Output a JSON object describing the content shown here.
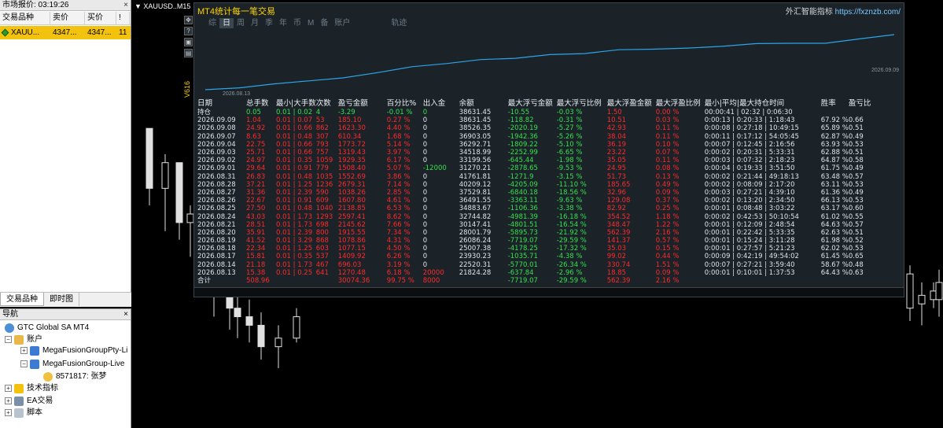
{
  "market_watch": {
    "title": "市场报价: 03:19:26",
    "columns": [
      "交易品种",
      "卖价",
      "买价",
      "!"
    ],
    "row": {
      "symbol": "XAUU...",
      "bid": "4347...",
      "ask": "4347...",
      "spread": "11"
    },
    "tabs": [
      "交易品种",
      "即时图"
    ]
  },
  "navigator": {
    "title": "导航",
    "root": "GTC Global SA MT4",
    "accounts_label": "账户",
    "server1": "MegaFusionGroupPty-Li",
    "server2": "MegaFusionGroup-Live",
    "account": "8571817: 张梦",
    "indicators": "技术指标",
    "ea": "EA交易",
    "scripts": "脚本"
  },
  "chart": {
    "symbol_label": "XAUUSD..M15",
    "candles": [
      {
        "o": 0.3,
        "h": 0.34,
        "l": 0.48,
        "c": 0.44
      },
      {
        "o": 0.44,
        "h": 0.36,
        "l": 0.54,
        "c": 0.38
      },
      {
        "o": 0.38,
        "h": 0.42,
        "l": 0.56,
        "c": 0.52
      },
      {
        "o": 0.52,
        "h": 0.48,
        "l": 0.6,
        "c": 0.5
      },
      {
        "o": 0.5,
        "h": 0.52,
        "l": 0.67,
        "c": 0.62
      },
      {
        "o": 0.62,
        "h": 0.58,
        "l": 0.74,
        "c": 0.66
      },
      {
        "o": 0.66,
        "h": 0.68,
        "l": 0.77,
        "c": 0.72
      },
      {
        "o": 0.72,
        "h": 0.68,
        "l": 0.79,
        "c": 0.74
      },
      {
        "o": 0.74,
        "h": 0.7,
        "l": 0.8,
        "c": 0.76
      },
      {
        "o": 0.76,
        "h": 0.73,
        "l": 0.84,
        "c": 0.81
      },
      {
        "o": 0.81,
        "h": 0.76,
        "l": 0.86,
        "c": 0.79
      },
      {
        "o": 0.79,
        "h": 0.72,
        "l": 0.8,
        "c": 0.74
      }
    ]
  },
  "panel": {
    "title": "MT4统计每一笔交易",
    "brand": "外汇智能指标",
    "brand_url": "https://fxznzb.com/",
    "tabs": [
      "综",
      "日",
      "周",
      "月",
      "季",
      "年",
      "币",
      "M",
      "备",
      "账户",
      "轨迹"
    ],
    "active_tab": "日",
    "date_start": "2026.08.13",
    "date_end": "2026.09.09",
    "version": "V616",
    "curve": [
      21824,
      22520,
      23930,
      25007,
      26086,
      28001,
      30147,
      32744,
      34883,
      36491,
      37529,
      40209,
      41761,
      31270,
      33199,
      34518,
      36292,
      36903,
      38526,
      38631,
      38631
    ],
    "columns": [
      "日期",
      "总手数",
      "最小|大手数",
      "次数",
      "盈亏金额",
      "百分比%",
      "出入金",
      "余额",
      "最大浮亏金额",
      "最大浮亏比例",
      "最大浮盈金额",
      "最大浮盈比例",
      "最小|平均|最大持仓时间",
      "胜率",
      "盈亏比"
    ],
    "hold_row": [
      "持仓",
      "0.05",
      "0.01 | 0.02",
      "4",
      "-3.29",
      "-0.01 %",
      "0",
      "38631.45",
      "-10.55",
      "-0.03 %",
      "1.50",
      "0.00 %",
      "00:00:41 | 02:32 | 0:06:30",
      "",
      ""
    ],
    "rows": [
      [
        "2026.09.09",
        "1.04",
        "0.01 | 0.07",
        "53",
        "185.10",
        "0.27 %",
        "0",
        "38631.45",
        "-118.82",
        "-0.31 %",
        "10.51",
        "0.03 %",
        "0:00:13 | 0:20:33 | 1:18:43",
        "67.92 %",
        "0.66"
      ],
      [
        "2026.09.08",
        "24.92",
        "0.01 | 0.66",
        "862",
        "1623.30",
        "4.40 %",
        "0",
        "38526.35",
        "-2020.19",
        "-5.27 %",
        "42.93",
        "0.11 %",
        "0:00:08 | 0:27:18 | 10:49:15",
        "65.89 %",
        "0.51"
      ],
      [
        "2026.09.07",
        "8.63",
        "0.01 | 0.48",
        "307",
        "610.34",
        "1.68 %",
        "0",
        "36903.05",
        "-1942.36",
        "-5.26 %",
        "38.04",
        "0.11 %",
        "0:00:11 | 0:17:12 | 54:05:45",
        "62.87 %",
        "0.49"
      ],
      [
        "2026.09.04",
        "22.75",
        "0.01 | 0.66",
        "793",
        "1773.72",
        "5.14 %",
        "0",
        "36292.71",
        "-1809.22",
        "-5.10 %",
        "36.19",
        "0.10 %",
        "0:00:07 | 0:12:45 | 2:16:56",
        "63.93 %",
        "0.53"
      ],
      [
        "2026.09.03",
        "25.71",
        "0.01 | 0.66",
        "757",
        "1319.43",
        "3.97 %",
        "0",
        "34518.99",
        "-2252.99",
        "-6.65 %",
        "23.22",
        "0.07 %",
        "0:00:02 | 0:20:31 | 5:33:31",
        "62.88 %",
        "0.51"
      ],
      [
        "2026.09.02",
        "24.97",
        "0.01 | 0.35",
        "1059",
        "1929.35",
        "6.17 %",
        "0",
        "33199.56",
        "-645.44",
        "-1.98 %",
        "35.05",
        "0.11 %",
        "0:00:03 | 0:07:32 | 2:18:23",
        "64.87 %",
        "0.58"
      ],
      [
        "2026.09.01",
        "29.64",
        "0.01 | 0.91",
        "779",
        "1508.40",
        "5.07 %",
        "-12000",
        "31270.21",
        "-2878.65",
        "-9.53 %",
        "24.95",
        "0.08 %",
        "0:00:04 | 0:19:33 | 3:51:50",
        "61.75 %",
        "0.49"
      ],
      [
        "2026.08.31",
        "26.83",
        "0.01 | 0.48",
        "1035",
        "1552.69",
        "3.86 %",
        "0",
        "41761.81",
        "-1271.9",
        "-3.15 %",
        "51.73",
        "0.13 %",
        "0:00:02 | 0:21:44 | 49:18:13",
        "63.48 %",
        "0.57"
      ],
      [
        "2026.08.28",
        "37.21",
        "0.01 | 1.25",
        "1236",
        "2679.31",
        "7.14 %",
        "0",
        "40209.12",
        "-4205.09",
        "-11.10 %",
        "185.65",
        "0.49 %",
        "0:00:02 | 0:08:09 | 2:17:20",
        "63.11 %",
        "0.53"
      ],
      [
        "2026.08.27",
        "31.36",
        "0.01 | 2.39",
        "590",
        "1038.26",
        "2.85 %",
        "0",
        "37529.81",
        "-6840.18",
        "-18.56 %",
        "32.96",
        "0.09 %",
        "0:00:03 | 0:27:21 | 4:39:10",
        "61.36 %",
        "0.49"
      ],
      [
        "2026.08.26",
        "22.67",
        "0.01 | 0.91",
        "609",
        "1607.80",
        "4.61 %",
        "0",
        "36491.55",
        "-3363.11",
        "-9.63 %",
        "129.08",
        "0.37 %",
        "0:00:02 | 0:13:20 | 2:34:50",
        "66.13 %",
        "0.53"
      ],
      [
        "2026.08.25",
        "27.50",
        "0.01 | 0.48",
        "1040",
        "2138.85",
        "6.53 %",
        "0",
        "34883.67",
        "-1106.36",
        "-3.38 %",
        "82.92",
        "0.25 %",
        "0:00:01 | 0:08:48 | 3:03:22",
        "63.17 %",
        "0.60"
      ],
      [
        "2026.08.24",
        "43.03",
        "0.01 | 1.73",
        "1293",
        "2597.41",
        "8.62 %",
        "0",
        "32744.82",
        "-4981.39",
        "-16.18 %",
        "354.52",
        "1.18 %",
        "0:00:02 | 0:42:53 | 50:10:54",
        "61.02 %",
        "0.55"
      ],
      [
        "2026.08.21",
        "28.51",
        "0.01 | 1.73",
        "698",
        "2145.62",
        "7.66 %",
        "0",
        "30147.41",
        "-4801.51",
        "-16.54 %",
        "348.47",
        "1.22 %",
        "0:00:01 | 0:12:09 | 2:48:54",
        "64.63 %",
        "0.57"
      ],
      [
        "2026.08.20",
        "35.91",
        "0.01 | 2.39",
        "800",
        "1915.55",
        "7.34 %",
        "0",
        "28001.79",
        "-5895.73",
        "-21.92 %",
        "562.39",
        "2.16 %",
        "0:00:01 | 0:22:42 | 5:33:35",
        "62.63 %",
        "0.51"
      ],
      [
        "2026.08.19",
        "41.52",
        "0.01 | 3.29",
        "868",
        "1078.86",
        "4.31 %",
        "0",
        "26086.24",
        "-7719.07",
        "-29.59 %",
        "141.37",
        "0.57 %",
        "0:00:01 | 0:15:24 | 3:11:28",
        "61.98 %",
        "0.52"
      ],
      [
        "2026.08.18",
        "22.34",
        "0.01 | 1.25",
        "603",
        "1077.15",
        "4.50 %",
        "0",
        "25007.38",
        "-4178.25",
        "-17.32 %",
        "35.03",
        "0.15 %",
        "0:00:01 | 0:27:57 | 5:21:23",
        "62.02 %",
        "0.53"
      ],
      [
        "2026.08.17",
        "15.81",
        "0.01 | 0.35",
        "537",
        "1409.92",
        "6.26 %",
        "0",
        "23930.23",
        "-1035.71",
        "-4.38 %",
        "99.02",
        "0.44 %",
        "0:00:09 | 0:42:19 | 49:54:02",
        "61.45 %",
        "0.65"
      ],
      [
        "2026.08.14",
        "21.18",
        "0.01 | 1.73",
        "467",
        "696.03",
        "3.19 %",
        "0",
        "22520.31",
        "-5770.01",
        "-26.34 %",
        "330.74",
        "1.51 %",
        "0:00:07 | 0:27:21 | 3:59:40",
        "58.67 %",
        "0.48"
      ],
      [
        "2026.08.13",
        "15.38",
        "0.01 | 0.25",
        "641",
        "1270.48",
        "6.18 %",
        "20000",
        "21824.28",
        "-637.84",
        "-2.96 %",
        "18.85",
        "0.09 %",
        "0:00:01 | 0:10:01 | 1:37:53",
        "64.43 %",
        "0.63"
      ]
    ],
    "total_row": [
      "合计",
      "508.96",
      "",
      "",
      "30074.36",
      "99.75 %",
      "8000",
      "",
      "-7719.07",
      "-29.59 %",
      "562.39",
      "2.16 %",
      "",
      "",
      ""
    ]
  },
  "colors": {
    "accent": "#f2c20f",
    "loss": "#ff2b2b",
    "gain": "#34e34f",
    "curve": "#2aa6e8"
  }
}
